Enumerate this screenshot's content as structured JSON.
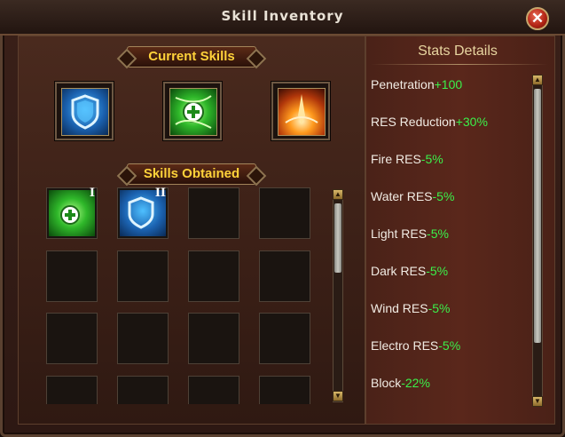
{
  "window": {
    "title": "Skill Inventory",
    "close_glyph": "✕"
  },
  "current_skills": {
    "label": "Current Skills",
    "slots": [
      {
        "icon": "shield-icon"
      },
      {
        "icon": "heal-icon"
      },
      {
        "icon": "fire-burst-icon"
      }
    ]
  },
  "skills_obtained": {
    "label": "Skills Obtained",
    "items": [
      {
        "icon": "heal-icon",
        "rank": "I"
      },
      {
        "icon": "shield-icon",
        "rank": "II"
      }
    ]
  },
  "stats": {
    "title": "Stats Details",
    "items": [
      {
        "label": "Penetration",
        "value": "+100"
      },
      {
        "label": "RES Reduction",
        "value": "+30%"
      },
      {
        "label": "Fire RES",
        "value": "-5%"
      },
      {
        "label": "Water RES",
        "value": "-5%"
      },
      {
        "label": "Light RES",
        "value": "-5%"
      },
      {
        "label": "Dark RES",
        "value": "-5%"
      },
      {
        "label": "Wind RES",
        "value": "-5%"
      },
      {
        "label": "Electro RES",
        "value": "-5%"
      },
      {
        "label": "Block",
        "value": "-22%"
      }
    ]
  },
  "colors": {
    "accent_gold": "#ffd23a",
    "value_green": "#3bf04a"
  }
}
